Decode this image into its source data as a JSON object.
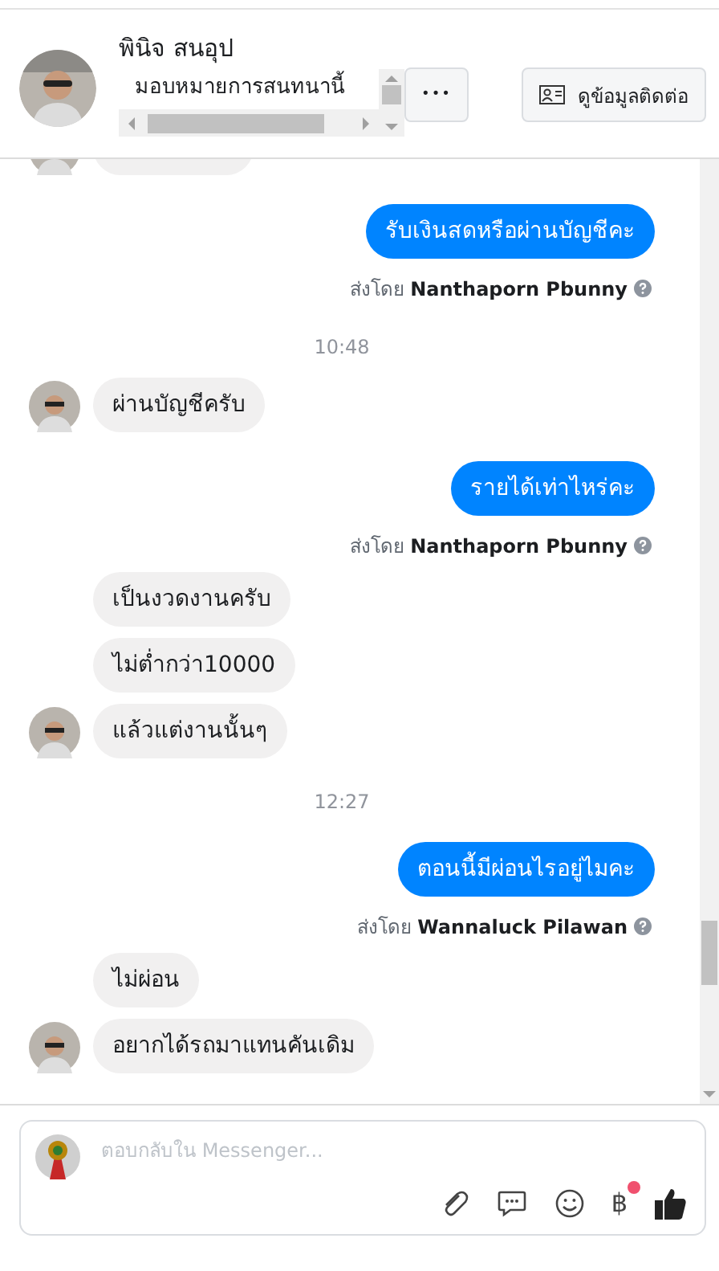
{
  "header": {
    "name": "พินิจ สนอุป",
    "subtitle": "มอบหมายการสนทนานี้",
    "more_button": "•••",
    "contact_button": "ดูข้อมูลติดต่อ"
  },
  "messages": [
    {
      "kind": "clipped",
      "avatar": true
    },
    {
      "kind": "outgoing",
      "text": "รับเงินสดหรือผ่านบัญชีคะ"
    },
    {
      "kind": "sender",
      "text": "ส่งโดย **Nanthaporn Pbunny**"
    },
    {
      "kind": "time",
      "text": "10:48"
    },
    {
      "kind": "incoming",
      "text": "ผ่านบัญชีครับ",
      "avatar": true
    },
    {
      "kind": "outgoing",
      "text": "รายได้เท่าไหร่คะ"
    },
    {
      "kind": "sender",
      "text": "ส่งโดย **Nanthaporn Pbunny**"
    },
    {
      "kind": "incoming",
      "text": "เป็นงวดงานครับ",
      "avatar": false
    },
    {
      "kind": "incoming",
      "text": "ไม่ต่ำกว่า10000",
      "avatar": false
    },
    {
      "kind": "incoming",
      "text": "แล้วแต่งานนั้นๆ",
      "avatar": true
    },
    {
      "kind": "time",
      "text": "12:27"
    },
    {
      "kind": "outgoing",
      "text": "ตอนนี้มีผ่อนไรอยู่ไมคะ"
    },
    {
      "kind": "sender",
      "text": "ส่งโดย **Wannaluck Pilawan**"
    },
    {
      "kind": "incoming",
      "text": "ไม่ผ่อน",
      "avatar": false
    },
    {
      "kind": "incoming",
      "text": "อยากได้รถมาแทนคันเดิม",
      "avatar": true
    }
  ],
  "composer": {
    "placeholder": "ตอบกลับใน Messenger...",
    "currency_symbol": "฿",
    "currency_notification": true
  }
}
